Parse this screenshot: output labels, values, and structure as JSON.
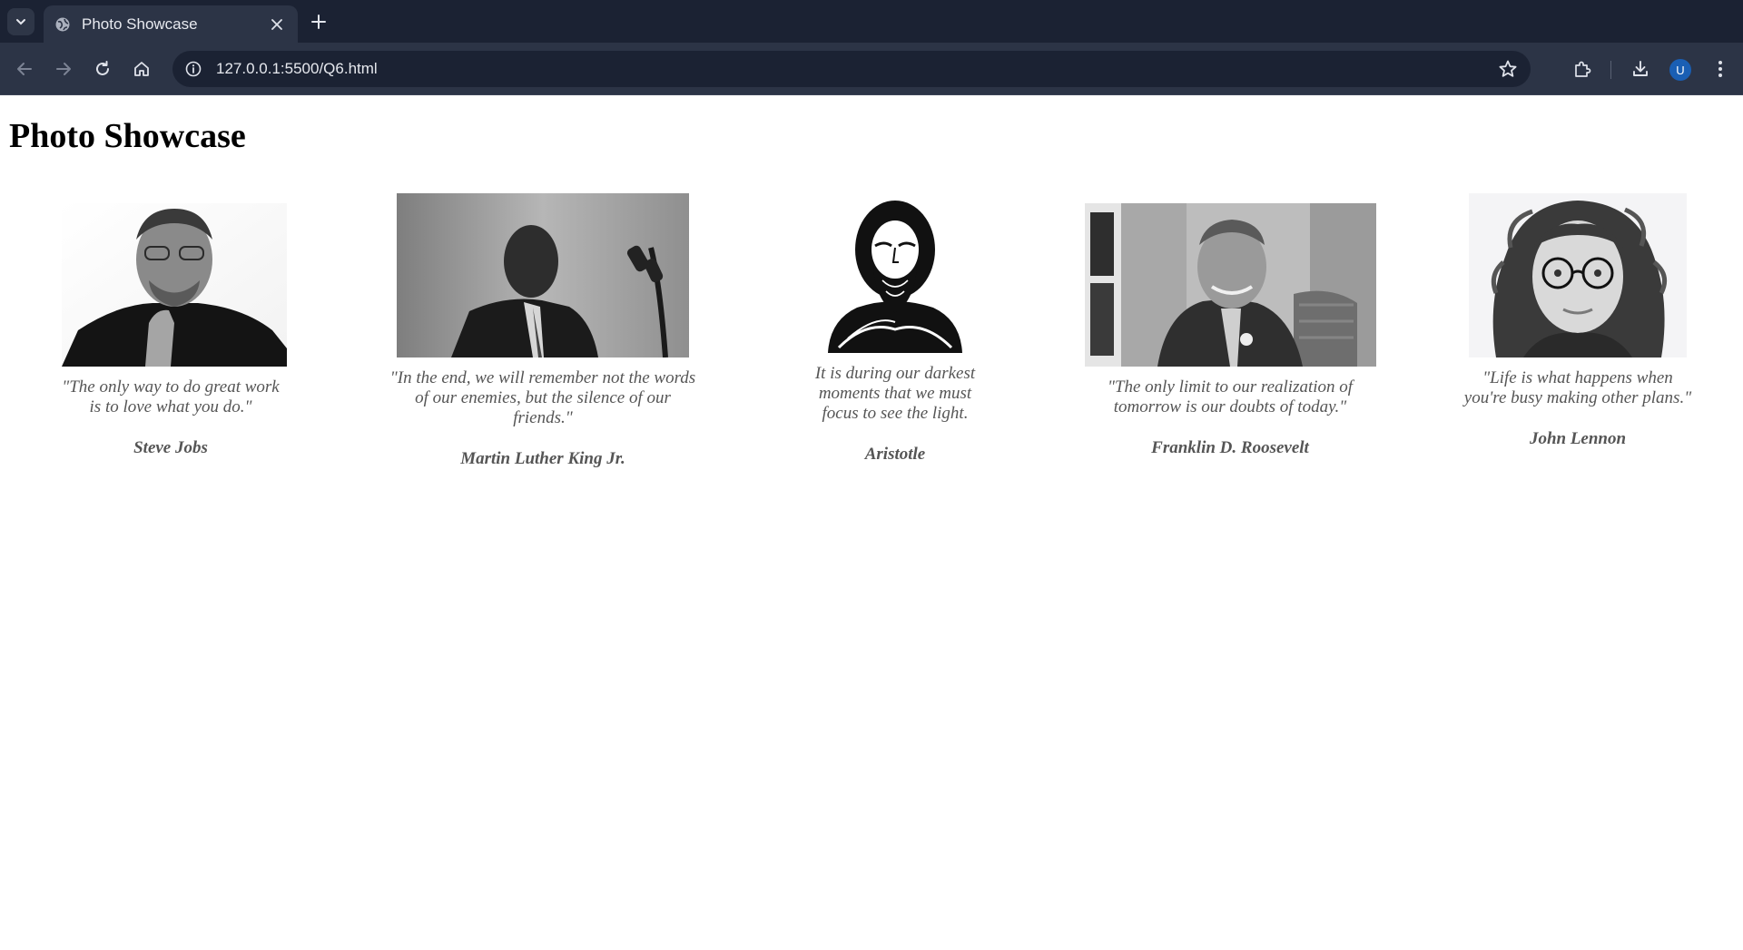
{
  "browser": {
    "tab_title": "Photo Showcase",
    "url": "127.0.0.1:5500/Q6.html",
    "profile_initial": "U"
  },
  "page": {
    "heading": "Photo Showcase",
    "cards": [
      {
        "quote": "\"The only way to do great work is to love what you do.\"",
        "author": "Steve Jobs"
      },
      {
        "quote": "\"In the end, we will remember not the words of our enemies, but the silence of our friends.\"",
        "author": "Martin Luther King Jr."
      },
      {
        "quote": "It is during our darkest moments that we must focus to see the light.",
        "author": "Aristotle"
      },
      {
        "quote": "\"The only limit to our realization of tomorrow is our doubts of today.\"",
        "author": "Franklin D. Roosevelt"
      },
      {
        "quote": "\"Life is what happens when you're busy making other plans.\"",
        "author": "John Lennon"
      }
    ]
  }
}
